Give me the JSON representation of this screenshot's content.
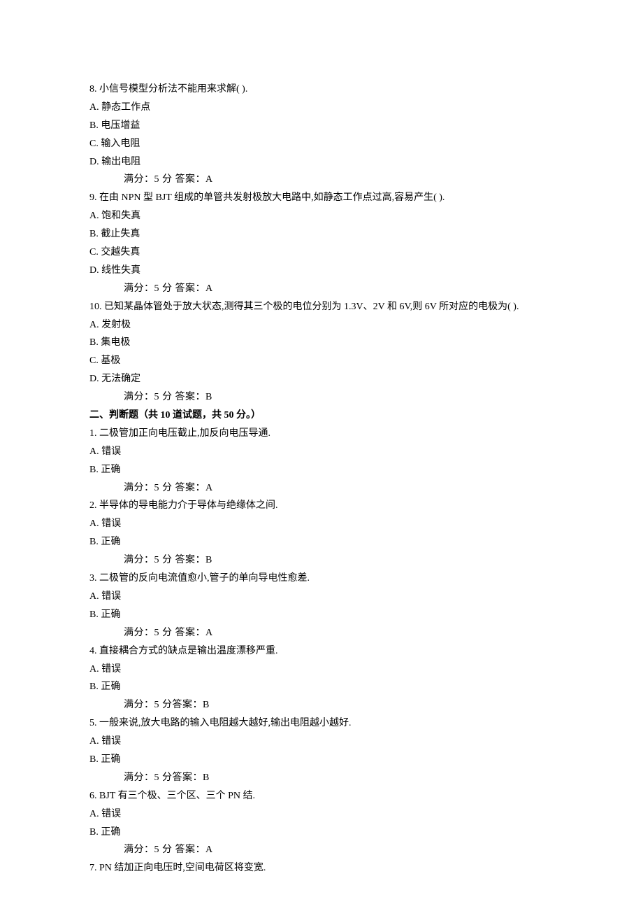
{
  "questions_mc": [
    {
      "num": "8.",
      "stem": "小信号模型分析法不能用来求解( ).",
      "options": [
        "A. 静态工作点",
        "B. 电压增益",
        "C. 输入电阻",
        "D. 输出电阻"
      ],
      "score": "满分：5   分    答案：A"
    },
    {
      "num": "9.",
      "stem": "在由 NPN 型 BJT 组成的单管共发射极放大电路中,如静态工作点过高,容易产生( ).",
      "options": [
        "A. 饱和失真",
        "B. 截止失真",
        "C. 交越失真",
        "D. 线性失真"
      ],
      "score": "满分：5   分    答案：A"
    },
    {
      "num": "10.",
      "stem": "已知某晶体管处于放大状态,测得其三个极的电位分别为 1.3V、2V 和 6V,则 6V 所对应的电极为( ).",
      "options": [
        "A. 发射极",
        "B. 集电极",
        "C. 基极",
        "D. 无法确定"
      ],
      "score": "满分：5   分     答案：B"
    }
  ],
  "section2_header": "二、判断题（共 10 道试题，共 50 分。）",
  "questions_tf": [
    {
      "num": "1.",
      "stem": "二极管加正向电压截止,加反向电压导通.",
      "options": [
        "A. 错误",
        "B. 正确"
      ],
      "score": "满分：5   分    答案：A"
    },
    {
      "num": "2.",
      "stem": "半导体的导电能力介于导体与绝缘体之间.",
      "options": [
        "A. 错误",
        "B. 正确"
      ],
      "score": "满分：5   分      答案：B"
    },
    {
      "num": "3.",
      "stem": "二极管的反向电流值愈小,管子的单向导电性愈差.",
      "options": [
        "A. 错误",
        "B. 正确"
      ],
      "score": "满分：5   分    答案：A"
    },
    {
      "num": "4.",
      "stem": "直接耦合方式的缺点是输出温度漂移严重.",
      "options": [
        "A. 错误",
        "B. 正确"
      ],
      "score": "满分：5   分答案：B"
    },
    {
      "num": "5.",
      "stem": "一般来说,放大电路的输入电阻越大越好,输出电阻越小越好.",
      "options": [
        "A. 错误",
        "B. 正确"
      ],
      "score": "满分：5   分答案：B"
    },
    {
      "num": "6.",
      "stem": "BJT 有三个极、三个区、三个 PN 结.",
      "options": [
        "A. 错误",
        "B. 正确"
      ],
      "score": "满分：5   分      答案：A"
    },
    {
      "num": "7.",
      "stem": "PN 结加正向电压时,空间电荷区将变宽.",
      "options": [],
      "score": ""
    }
  ]
}
